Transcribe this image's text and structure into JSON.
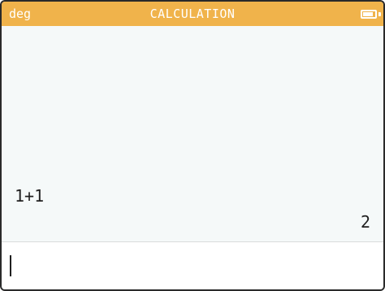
{
  "status_bar": {
    "angle_mode": "deg",
    "app_title": "CALCULATION",
    "battery_icon": "battery-icon",
    "battery_level": 0.85,
    "accent_color": "#f0b34b"
  },
  "history": {
    "entries": [
      {
        "expression": "1+1",
        "result": "2"
      }
    ]
  },
  "input": {
    "value": ""
  }
}
